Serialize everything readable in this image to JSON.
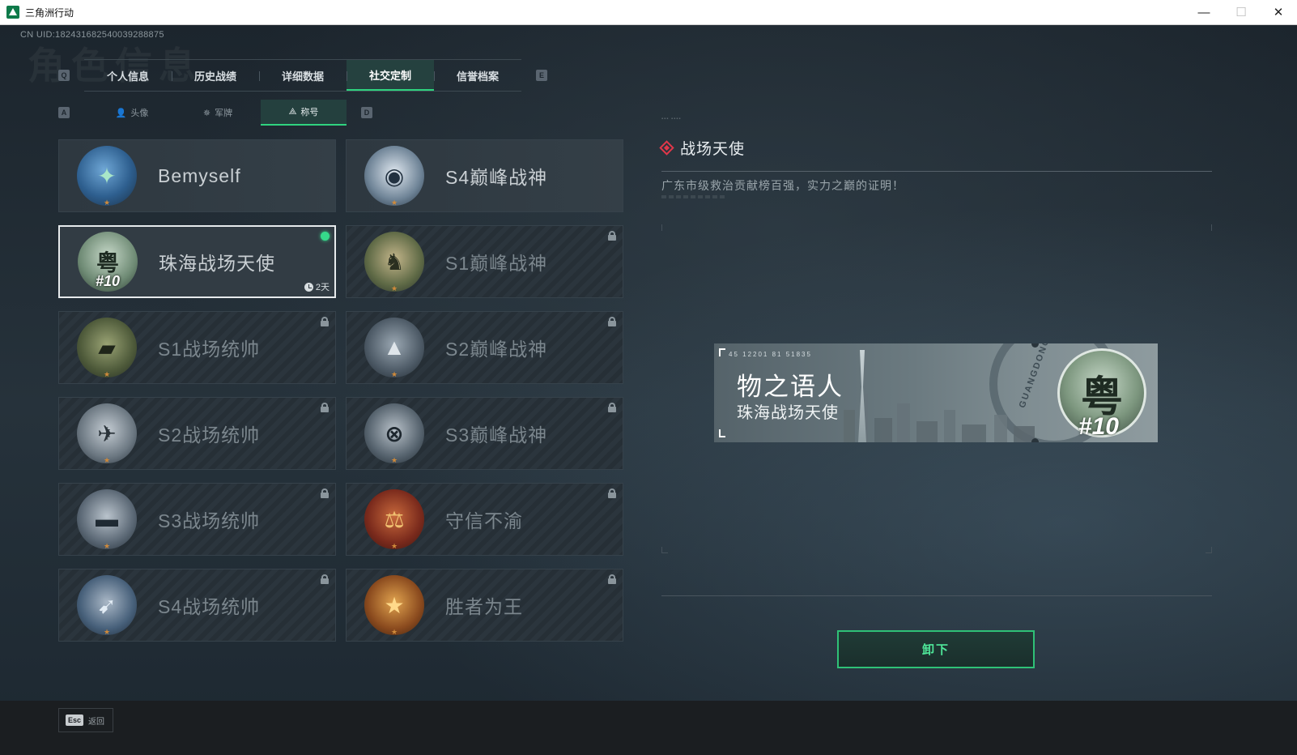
{
  "window": {
    "title": "三角洲行动",
    "minimize": "—",
    "maximize": "☐",
    "close": "✕"
  },
  "header": {
    "uid": "CN UID:182431682540039288875",
    "bg_title": "角色信息"
  },
  "tabs": {
    "prev_key": "Q",
    "next_key": "E",
    "items": [
      {
        "label": "个人信息"
      },
      {
        "label": "历史战绩"
      },
      {
        "label": "详细数据"
      },
      {
        "label": "社交定制",
        "active": true
      },
      {
        "label": "信誉档案"
      }
    ]
  },
  "subtabs": {
    "prev_key": "A",
    "next_key": "D",
    "items": [
      {
        "label": "头像",
        "icon": "person-icon",
        "glyph": "👤"
      },
      {
        "label": "军牌",
        "icon": "laurel-icon",
        "glyph": "✵"
      },
      {
        "label": "称号",
        "icon": "triangle-icon",
        "glyph": "⟁",
        "active": true
      }
    ]
  },
  "titles": [
    {
      "name": "Bemyself",
      "locked": false,
      "glyph": "✦"
    },
    {
      "name": "S4巅峰战神",
      "locked": false,
      "glyph": "◉"
    },
    {
      "name": "珠海战场天使",
      "locked": false,
      "selected": true,
      "equipped": true,
      "duration": "2天",
      "glyph": "粤",
      "badge": "#10"
    },
    {
      "name": "S1巅峰战神",
      "locked": true,
      "glyph": "♞"
    },
    {
      "name": "S1战场统帅",
      "locked": true,
      "glyph": "▰"
    },
    {
      "name": "S2巅峰战神",
      "locked": true,
      "glyph": "▲"
    },
    {
      "name": "S2战场统帅",
      "locked": true,
      "glyph": "✈"
    },
    {
      "name": "S3巅峰战神",
      "locked": true,
      "glyph": "⊗"
    },
    {
      "name": "S3战场统帅",
      "locked": true,
      "glyph": "▬"
    },
    {
      "name": "守信不渝",
      "locked": true,
      "glyph": "⚖"
    },
    {
      "name": "S4战场统帅",
      "locked": true,
      "glyph": "➹"
    },
    {
      "name": "胜者为王",
      "locked": true,
      "glyph": "★"
    }
  ],
  "detail": {
    "title": "战场天使",
    "description": "广东市级救治贡献榜百强，实力之巅的证明！",
    "banner": {
      "code": "45 12201  81 51835",
      "player_name": "物之语人",
      "title_name": "珠海战场天使",
      "ring_text": "GUANGDONG",
      "emblem_glyph": "粤",
      "rank": "#10"
    },
    "button_label": "卸下"
  },
  "footer": {
    "esc_key": "Esc",
    "esc_label": "返回"
  },
  "colors": {
    "accent_green": "#2fd37f",
    "equipped_dot": "#36d98a",
    "diamond_red": "#e0374a"
  }
}
